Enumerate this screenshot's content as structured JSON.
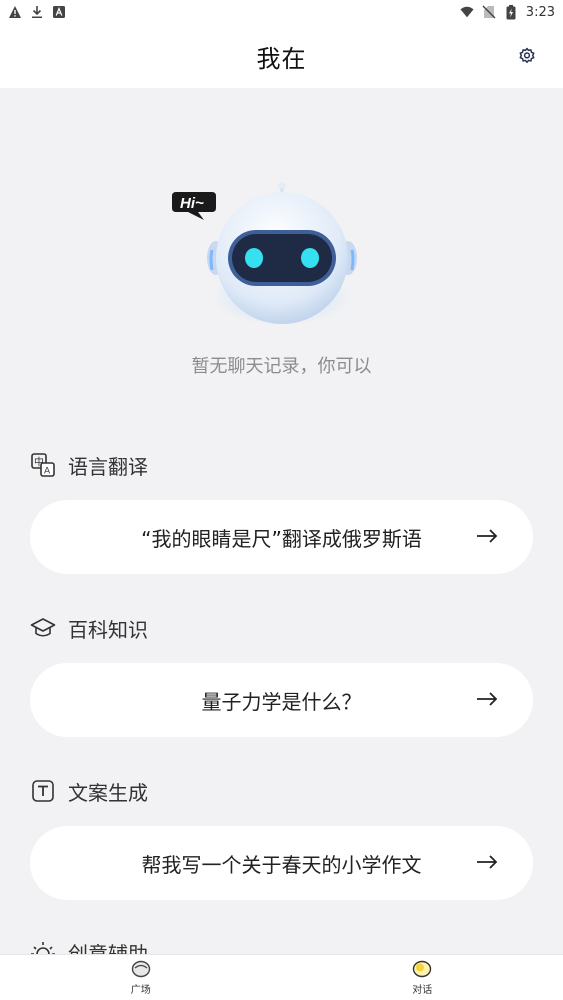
{
  "status_bar": {
    "time": "3:23",
    "left_icons": [
      "warning-icon",
      "download-icon",
      "a-box-icon"
    ],
    "right_icons": [
      "wifi-icon",
      "no-sim-icon",
      "battery-charging-icon"
    ]
  },
  "header": {
    "title": "我在",
    "settings_icon": "gear-icon"
  },
  "hero": {
    "badge_text": "Hi~",
    "empty_text": "暂无聊天记录，你可以"
  },
  "sections": [
    {
      "icon": "translate-icon",
      "title": "语言翻译",
      "prompt": "“我的眼睛是尺”翻译成俄罗斯语"
    },
    {
      "icon": "graduation-cap-icon",
      "title": "百科知识",
      "prompt": "量子力学是什么？"
    },
    {
      "icon": "text-box-icon",
      "title": "文案生成",
      "prompt": "帮我写一个关于春天的小学作文"
    },
    {
      "icon": "bulb-icon",
      "title": "创意辅助"
    }
  ],
  "tabbar": {
    "tabs": [
      {
        "label": "广场",
        "icon": "plaza-icon",
        "active": false
      },
      {
        "label": "对话",
        "icon": "chat-icon",
        "active": true
      }
    ]
  },
  "colors": {
    "background": "#f2f2f4",
    "card": "#ffffff",
    "robot_eye": "#35e0f0",
    "robot_face": "#1f2a44"
  }
}
